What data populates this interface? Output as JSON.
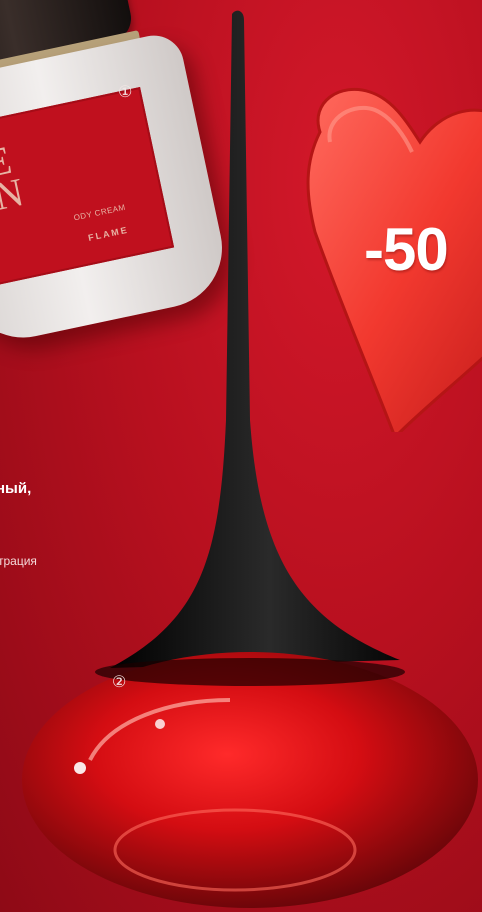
{
  "jar": {
    "label_line1": "E",
    "label_line2": "ON",
    "label_line3": "ODY CREAM",
    "brand": "FLAME",
    "marker": "①"
  },
  "promo": {
    "discount": "-50"
  },
  "text": {
    "fragment_bold": "ный,",
    "fragment_light": "трация"
  },
  "bottle": {
    "marker": "②"
  },
  "colors": {
    "background": "#b8101f",
    "heart": "#f03a3a",
    "bottle_cap": "#111111"
  }
}
